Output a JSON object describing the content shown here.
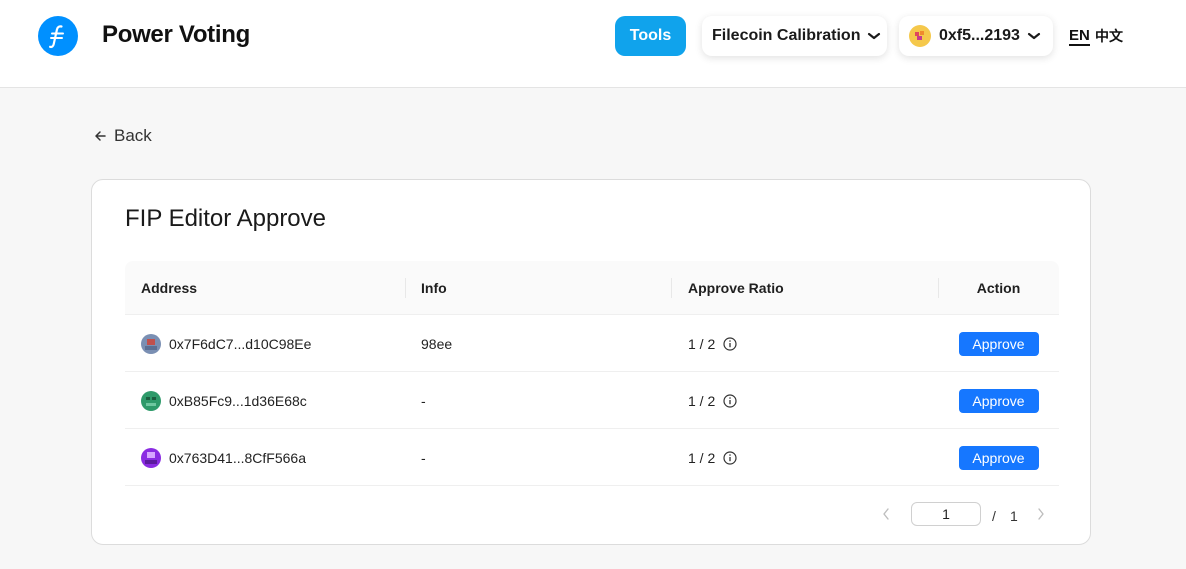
{
  "header": {
    "app_title": "Power Voting",
    "logo_icon": "filecoin-logo-icon",
    "tools_label": "Tools",
    "network_label": "Filecoin Calibration",
    "wallet_address": "0xf5...2193",
    "lang_en": "EN",
    "lang_zh": "中文"
  },
  "nav": {
    "back_label": "Back"
  },
  "card": {
    "title": "FIP Editor Approve",
    "columns": {
      "address": "Address",
      "info": "Info",
      "ratio": "Approve Ratio",
      "action": "Action"
    },
    "rows": [
      {
        "address_start": "0x7F6dC7",
        "address_end": "d10C98Ee",
        "info": "98ee",
        "ratio": "1 / 2",
        "action": "Approve"
      },
      {
        "address_start": "0xB85Fc9",
        "address_end": "1d36E68c",
        "info": "-",
        "ratio": "1 / 2",
        "action": "Approve"
      },
      {
        "address_start": "0x763D41",
        "address_end": "8CfF566a",
        "info": "-",
        "ratio": "1 / 2",
        "action": "Approve"
      }
    ],
    "ellipsis": "...",
    "pagination": {
      "current": "1",
      "separator": "/",
      "total": "1"
    }
  },
  "colors": {
    "accent_blue": "#1677ff",
    "tools_blue": "#10a3ec",
    "logo_blue": "#0090ff",
    "avatar_row1": "#7a8fb3",
    "avatar_row2": "#2e9a6a",
    "avatar_row3": "#8a2be2"
  }
}
